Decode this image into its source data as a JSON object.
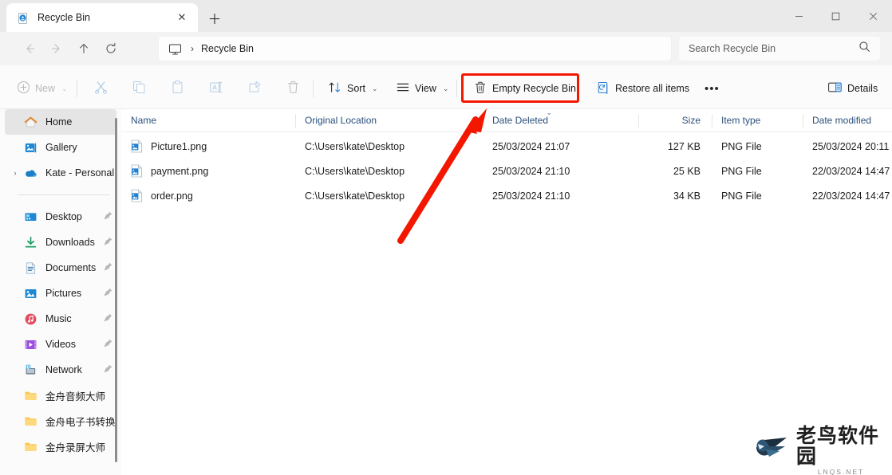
{
  "window": {
    "tab": {
      "title": "Recycle Bin",
      "icon": "recycle-bin-icon",
      "close": "✕",
      "new_tab": "＋"
    },
    "controls": {
      "minimize": "─",
      "maximize": "□",
      "close": "✕"
    }
  },
  "nav": {
    "back": "←",
    "forward": "→",
    "up": "↑",
    "refresh": "⟳",
    "address": {
      "icon": "monitor-icon",
      "separator": "›",
      "path": "Recycle Bin"
    },
    "search": {
      "placeholder": "Search Recycle Bin",
      "value": "",
      "icon": "search-icon"
    }
  },
  "toolbar": {
    "new_label": "New",
    "cut_label": "Cut",
    "copy_label": "Copy",
    "paste_label": "Paste",
    "rename_label": "Rename",
    "share_label": "Share",
    "delete_label": "Delete",
    "sort_label": "Sort",
    "view_label": "View",
    "empty_recycle_bin_label": "Empty Recycle Bin",
    "restore_all_label": "Restore all items",
    "more_label": "•••",
    "details_label": "Details",
    "chevron": "⌄",
    "highlight_color": "#f31700"
  },
  "sidebar": {
    "top_items": [
      {
        "label": "Home",
        "icon": "home-icon",
        "selected": true,
        "pinned": false,
        "expandable": false
      },
      {
        "label": "Gallery",
        "icon": "gallery-icon",
        "selected": false,
        "pinned": false,
        "expandable": false
      },
      {
        "label": "Kate - Personal",
        "icon": "onedrive-icon",
        "selected": false,
        "pinned": false,
        "expandable": true
      }
    ],
    "pinned_items": [
      {
        "label": "Desktop",
        "icon": "desktop-icon",
        "pinned": true
      },
      {
        "label": "Downloads",
        "icon": "downloads-icon",
        "pinned": true
      },
      {
        "label": "Documents",
        "icon": "documents-icon",
        "pinned": true
      },
      {
        "label": "Pictures",
        "icon": "pictures-icon",
        "pinned": true
      },
      {
        "label": "Music",
        "icon": "music-icon",
        "pinned": true
      },
      {
        "label": "Videos",
        "icon": "videos-icon",
        "pinned": true
      },
      {
        "label": "Network",
        "icon": "network-icon",
        "pinned": true
      },
      {
        "label": "金舟音频大师",
        "icon": "folder-icon",
        "pinned": false
      },
      {
        "label": "金舟电子书转换",
        "icon": "folder-icon",
        "pinned": false
      },
      {
        "label": "金舟录屏大师",
        "icon": "folder-icon",
        "pinned": false
      }
    ],
    "expander": "›",
    "pin_icon": "pin-icon"
  },
  "filelist": {
    "columns": [
      {
        "key": "name",
        "label": "Name",
        "sorted": false
      },
      {
        "key": "location",
        "label": "Original Location",
        "sorted": false
      },
      {
        "key": "date_deleted",
        "label": "Date Deleted",
        "sorted": true,
        "sort_dir": "⌄"
      },
      {
        "key": "size",
        "label": "Size",
        "sorted": false
      },
      {
        "key": "item_type",
        "label": "Item type",
        "sorted": false
      },
      {
        "key": "date_modified",
        "label": "Date modified",
        "sorted": false
      }
    ],
    "rows": [
      {
        "name": "Picture1.png",
        "icon": "png-file-icon",
        "location": "C:\\Users\\kate\\Desktop",
        "date_deleted": "25/03/2024 21:07",
        "size": "127 KB",
        "item_type": "PNG File",
        "date_modified": "25/03/2024 20:11"
      },
      {
        "name": "payment.png",
        "icon": "png-file-icon",
        "location": "C:\\Users\\kate\\Desktop",
        "date_deleted": "25/03/2024 21:10",
        "size": "25 KB",
        "item_type": "PNG File",
        "date_modified": "22/03/2024 14:47"
      },
      {
        "name": "order.png",
        "icon": "png-file-icon",
        "location": "C:\\Users\\kate\\Desktop",
        "date_deleted": "25/03/2024 21:10",
        "size": "34 KB",
        "item_type": "PNG File",
        "date_modified": "22/03/2024 14:47"
      }
    ]
  },
  "annotation": {
    "arrow_color": "#f31700",
    "arrow_points_to": "Empty Recycle Bin"
  },
  "watermark": {
    "title": "老鸟软件园",
    "subtitle": "LNQS.NET",
    "logo": "bird-logo-icon"
  }
}
